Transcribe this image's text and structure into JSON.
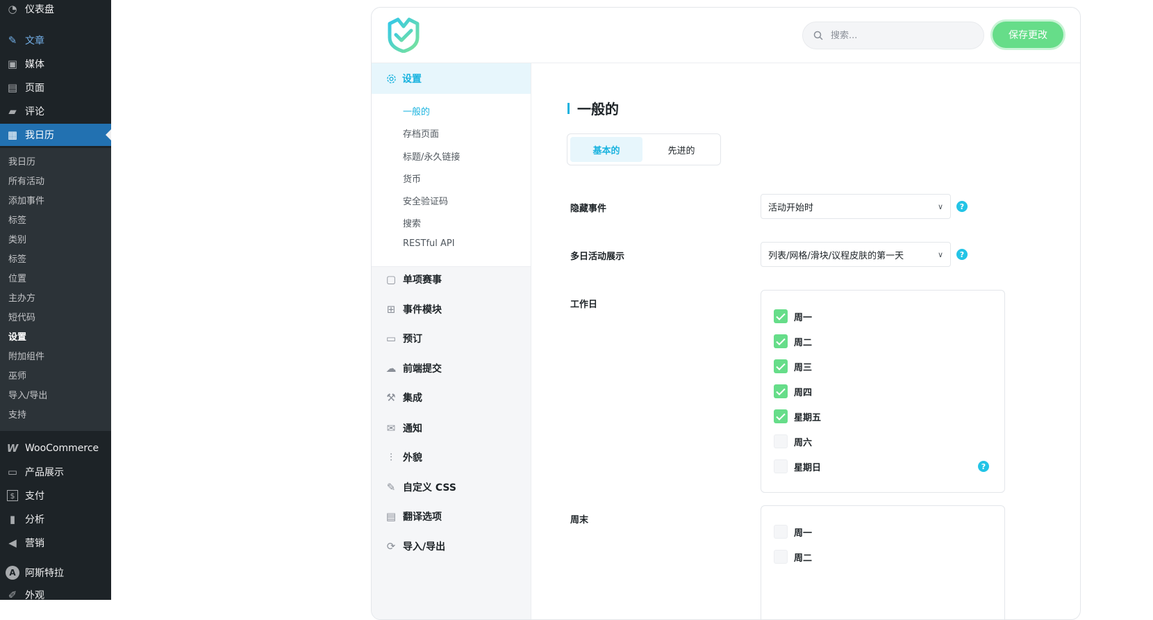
{
  "wp_menu": {
    "dashboard": "仪表盘",
    "posts": "文章",
    "media": "媒体",
    "pages": "页面",
    "comments": "评论",
    "my_calendar": "我日历",
    "submenu": [
      "我日历",
      "所有活动",
      "添加事件",
      "标签",
      "类别",
      "标签",
      "位置",
      "主办方",
      "短代码",
      "设置",
      "附加组件",
      "巫师",
      "导入/导出",
      "支持"
    ],
    "woocommerce": "WooCommerce",
    "products": "产品展示",
    "payments": "支付",
    "analytics": "分析",
    "marketing": "营销",
    "astra": "阿斯特拉",
    "appearance": "外观"
  },
  "topbar": {
    "search_placeholder": "搜索...",
    "save_label": "保存更改"
  },
  "nav": {
    "settings": "设置",
    "settings_sub": [
      "一般的",
      "存档页面",
      "标题/永久链接",
      "货币",
      "安全验证码",
      "搜索",
      "RESTful API"
    ],
    "items": [
      "单项赛事",
      "事件模块",
      "预订",
      "前端提交",
      "集成",
      "通知",
      "外貌",
      "自定义 CSS",
      "翻译选项",
      "导入/导出"
    ]
  },
  "content": {
    "title": "一般的",
    "tabs": [
      "基本的",
      "先进的"
    ],
    "hide_events_label": "隐藏事件",
    "hide_events_value": "活动开始时",
    "multiday_label": "多日活动展示",
    "multiday_value": "列表/网格/滑块/议程皮肤的第一天",
    "weekdays_label": "工作日",
    "weekdays": [
      {
        "label": "周一",
        "checked": true
      },
      {
        "label": "周二",
        "checked": true
      },
      {
        "label": "周三",
        "checked": true
      },
      {
        "label": "周四",
        "checked": true
      },
      {
        "label": "星期五",
        "checked": true
      },
      {
        "label": "周六",
        "checked": false
      },
      {
        "label": "星期日",
        "checked": false
      }
    ],
    "weekend_label": "周末",
    "weekend": [
      {
        "label": "周一",
        "checked": false
      },
      {
        "label": "周二",
        "checked": false
      }
    ]
  },
  "colors": {
    "accent": "#1ab3df",
    "success": "#66dd89",
    "wp_active": "#2271b1",
    "wp_sidebar": "#1d2327"
  }
}
